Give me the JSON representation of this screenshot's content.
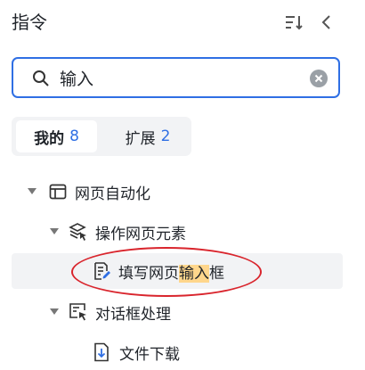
{
  "header": {
    "title": "指令",
    "sort_icon": "sort-icon",
    "collapse_icon": "chevron-left-icon"
  },
  "search": {
    "value": "输入",
    "placeholder": "",
    "accent": "#2f6fe4"
  },
  "tabs": [
    {
      "label": "我的",
      "count": "8",
      "active": true
    },
    {
      "label": "扩展",
      "count": "2",
      "active": false
    }
  ],
  "tree": {
    "n1": {
      "label": "网页自动化",
      "icon": "browser-window-icon"
    },
    "n2": {
      "label": "操作网页元素",
      "icon": "layers-cursor-icon"
    },
    "n3": {
      "label_pre": "填写网页",
      "label_match": "输入",
      "label_post": "框",
      "icon": "edit-document-icon"
    },
    "n4": {
      "label": "对话框处理",
      "icon": "dialog-cursor-icon"
    },
    "n5": {
      "label": "文件下载",
      "icon": "file-download-icon"
    }
  },
  "colors": {
    "highlight": "#ffd68c",
    "annotation_ring": "#d9252d",
    "selected_row": "#f2f3f5"
  }
}
